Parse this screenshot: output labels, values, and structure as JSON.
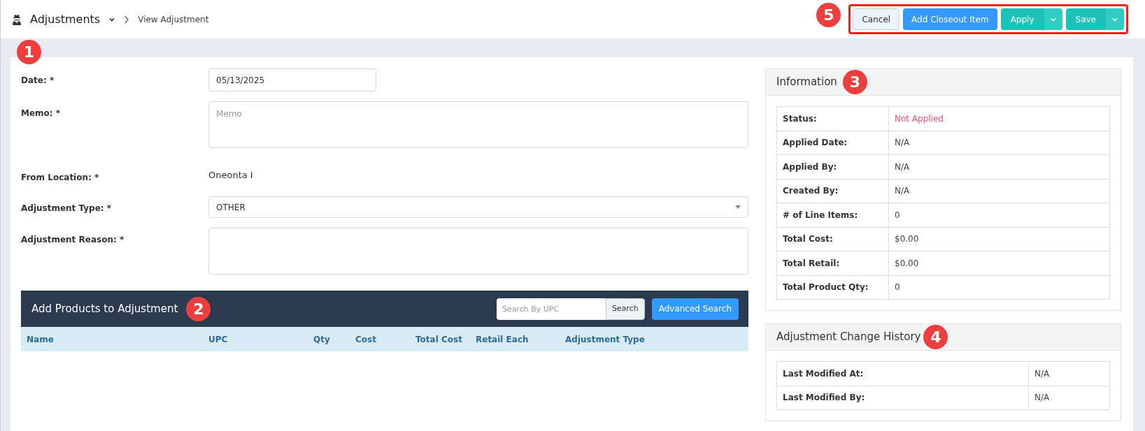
{
  "header": {
    "title": "Adjustments",
    "breadcrumb": "View Adjustment",
    "actions": [
      {
        "label": "Cancel",
        "kind": "plain",
        "split": false
      },
      {
        "label": "Add Closeout Item",
        "kind": "primary",
        "split": false
      },
      {
        "label": "Apply",
        "kind": "success",
        "split": true
      },
      {
        "label": "Save",
        "kind": "success",
        "split": true
      }
    ]
  },
  "callouts": [
    "1",
    "2",
    "3",
    "4",
    "5"
  ],
  "form": [
    {
      "label": "Date: *",
      "kind": "input",
      "value": "05/13/2025"
    },
    {
      "label": "Memo: *",
      "kind": "textarea",
      "placeholder": "Memo"
    },
    {
      "label": "From Location: *",
      "kind": "text",
      "value": "Oneonta I"
    },
    {
      "label": "Adjustment Type: *",
      "kind": "select",
      "value": "OTHER"
    },
    {
      "label": "Adjustment Reason: *",
      "kind": "textarea"
    }
  ],
  "products": {
    "title": "Add Products to Adjustment",
    "search_placeholder": "Search By UPC",
    "search_button": "Search",
    "advanced_button": "Advanced Search",
    "columns": [
      "Name",
      "UPC",
      "Qty",
      "Cost",
      "Total Cost",
      "Retail Each",
      "Adjustment Type"
    ]
  },
  "information": {
    "title": "Information",
    "rows": [
      {
        "label": "Status:",
        "value": "Not Applied",
        "color": "#f0506e"
      },
      {
        "label": "Applied Date:",
        "value": "N/A"
      },
      {
        "label": "Applied By:",
        "value": "N/A"
      },
      {
        "label": "Created By:",
        "value": "N/A"
      },
      {
        "label": "# of Line Items:",
        "value": "0"
      },
      {
        "label": "Total Cost:",
        "value": "$0.00"
      },
      {
        "label": "Total Retail:",
        "value": "$0.00"
      },
      {
        "label": "Total Product Qty:",
        "value": "0"
      }
    ]
  },
  "history": {
    "title": "Adjustment Change History",
    "rows": [
      {
        "label": "Last Modified At:",
        "value": "N/A"
      },
      {
        "label": "Last Modified By:",
        "value": "N/A"
      }
    ]
  }
}
